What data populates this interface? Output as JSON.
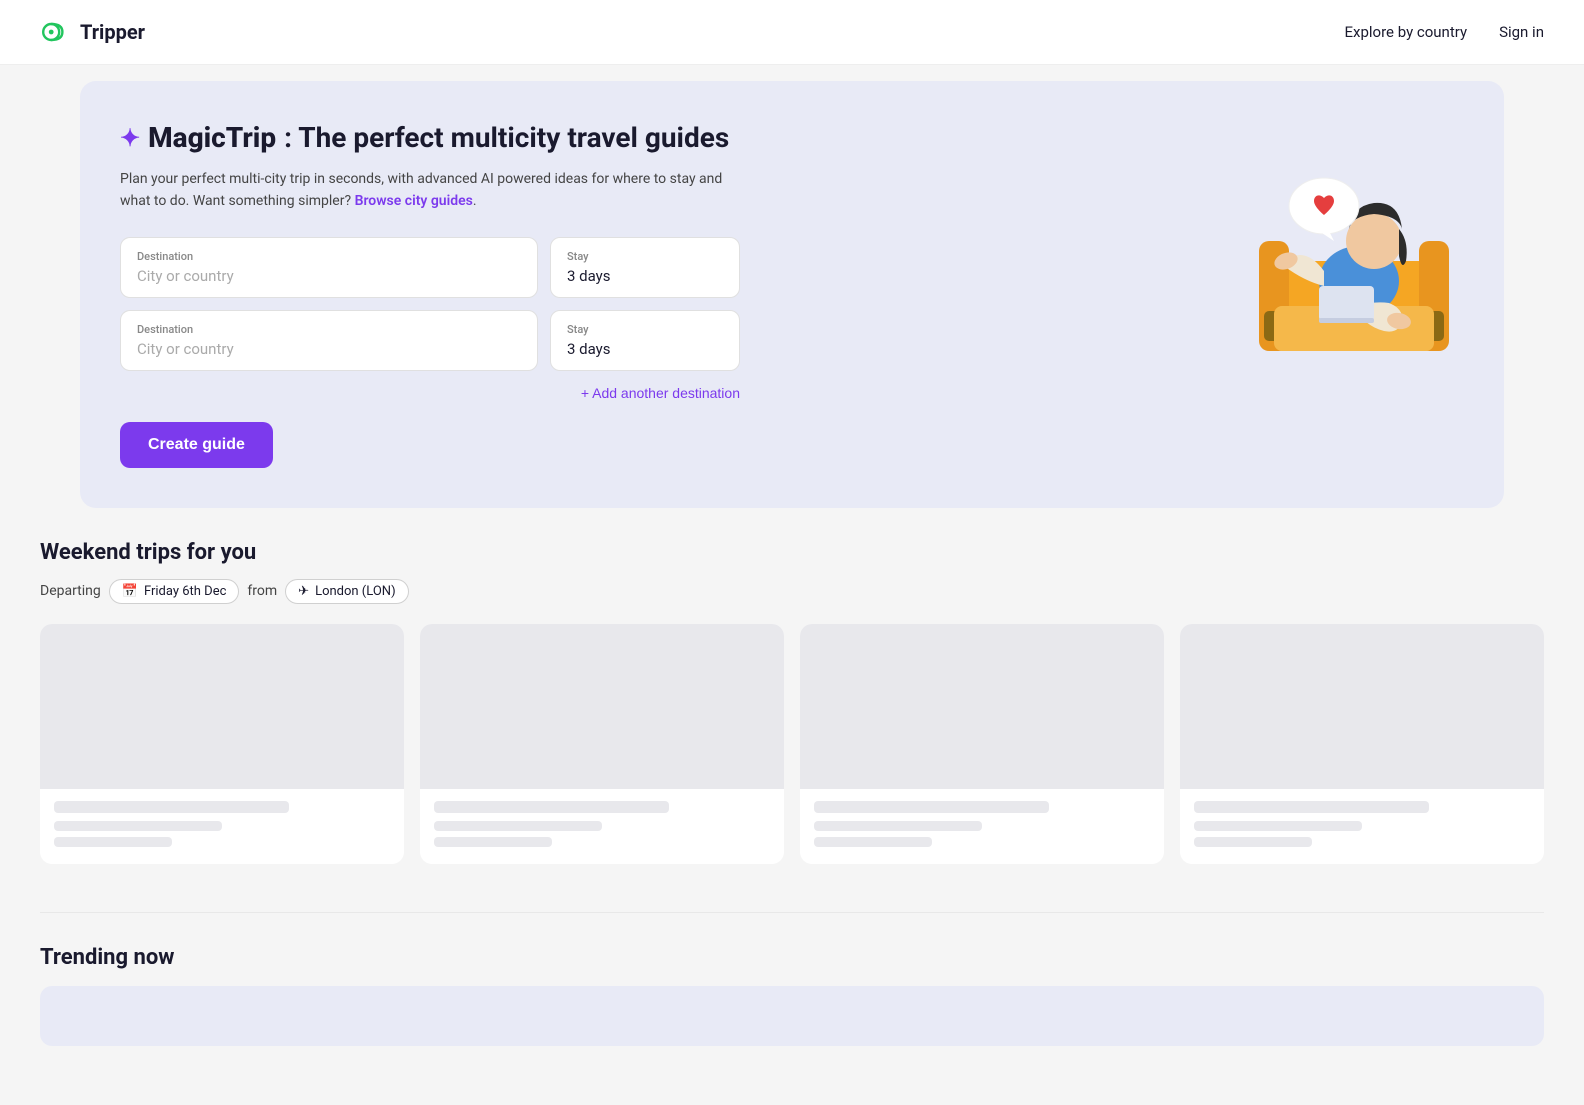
{
  "nav": {
    "logo_text": "Tripper",
    "explore_label": "Explore by country",
    "signin_label": "Sign in"
  },
  "hero": {
    "sparkle": "✦",
    "title_brand": "MagicTrip",
    "title_rest": ": The perfect multicity travel guides",
    "description": "Plan your perfect multi-city trip in seconds, with advanced AI powered ideas for where to stay and what to do. Want something simpler?",
    "browse_label": "Browse city guides",
    "browse_period": ".",
    "destination1": {
      "dest_label": "Destination",
      "dest_placeholder": "City or country",
      "stay_label": "Stay",
      "stay_value": "3 days"
    },
    "destination2": {
      "dest_label": "Destination",
      "dest_placeholder": "City or country",
      "stay_label": "Stay",
      "stay_value": "3 days"
    },
    "add_destination_label": "+ Add another destination",
    "create_guide_label": "Create guide"
  },
  "weekend": {
    "section_title": "Weekend trips for you",
    "departing_label": "Departing",
    "from_label": "from",
    "date_icon": "📅",
    "date_label": "Friday 6th Dec",
    "flight_icon": "✈",
    "location_label": "London (LON)"
  },
  "trending": {
    "section_title": "Trending now"
  }
}
